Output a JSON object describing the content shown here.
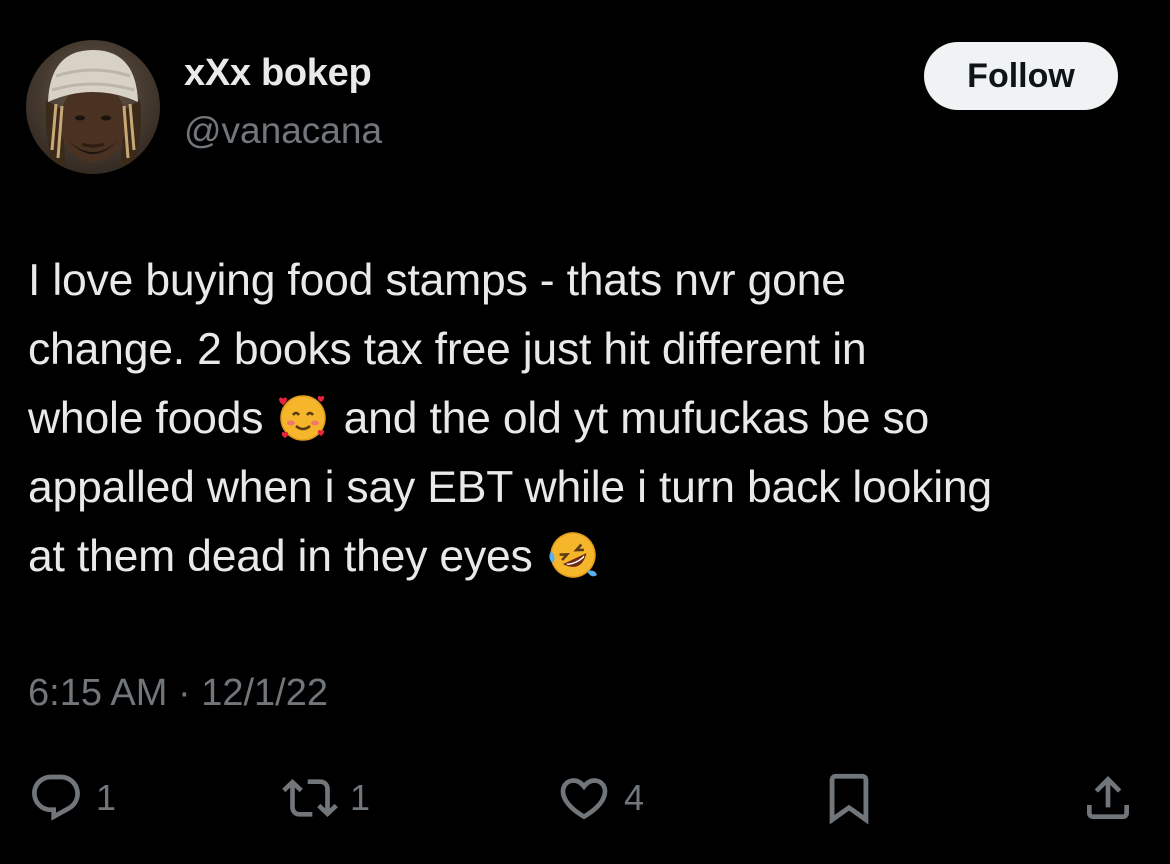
{
  "author": {
    "display_name": "xXx bokep",
    "handle": "@vanacana",
    "avatar_icon": "user-avatar-photo"
  },
  "follow_button": {
    "label": "Follow"
  },
  "tweet": {
    "lines": [
      {
        "before": "I love buying food stamps - thats nvr gone",
        "emoji": null,
        "after": ""
      },
      {
        "before": "change. 2 books tax free just hit different in",
        "emoji": null,
        "after": ""
      },
      {
        "before": "whole foods ",
        "emoji": "smiling-face-with-hearts",
        "after": " and the old yt mufuckas be so"
      },
      {
        "before": "appalled when i say EBT while i turn back looking",
        "emoji": null,
        "after": ""
      },
      {
        "before": "at them dead in they eyes ",
        "emoji": "rolling-on-floor-laughing",
        "after": ""
      }
    ],
    "timestamp": "6:15 AM · 12/1/22"
  },
  "actions": {
    "reply": {
      "icon": "reply-icon",
      "count": "1"
    },
    "retweet": {
      "icon": "retweet-icon",
      "count": "1"
    },
    "like": {
      "icon": "heart-icon",
      "count": "4"
    },
    "bookmark": {
      "icon": "bookmark-icon"
    },
    "share": {
      "icon": "share-icon"
    }
  },
  "colors": {
    "background": "#000000",
    "primary_text": "#e7e9ea",
    "secondary_text": "#71767b",
    "follow_bg": "#eff3f4",
    "follow_text": "#0f1419"
  }
}
